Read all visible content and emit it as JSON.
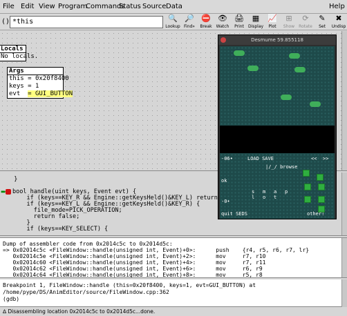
{
  "menubar": {
    "items": [
      "File",
      "Edit",
      "View",
      "Program",
      "Commands",
      "Status",
      "Source",
      "Data"
    ],
    "help": "Help"
  },
  "toolbar": {
    "arg_label": "():",
    "arg_value": "*this",
    "buttons": [
      {
        "label": "Lookup",
        "icon": "lookup-icon",
        "enabled": true
      },
      {
        "label": "Find»",
        "icon": "find-icon",
        "enabled": true
      },
      {
        "label": "Break",
        "icon": "break-icon",
        "enabled": true
      },
      {
        "label": "Watch",
        "icon": "watch-icon",
        "enabled": true
      },
      {
        "label": "Print",
        "icon": "print-icon",
        "enabled": true
      },
      {
        "label": "Display",
        "icon": "display-icon",
        "enabled": true
      },
      {
        "label": "Plot",
        "icon": "plot-icon",
        "enabled": true
      },
      {
        "label": "Show",
        "icon": "show-icon",
        "enabled": false
      },
      {
        "label": "Rotate",
        "icon": "rotate-icon",
        "enabled": false
      },
      {
        "label": "Set",
        "icon": "set-icon",
        "enabled": true
      },
      {
        "label": "Undisp",
        "icon": "undisp-icon",
        "enabled": true
      }
    ]
  },
  "data": {
    "locals": {
      "title": "Locals",
      "rows": [
        "No locals."
      ]
    },
    "args": {
      "title": "Args",
      "rows": [
        {
          "name": "this",
          "value": "= 0x20f8400"
        },
        {
          "name": "keys",
          "value": "= 1"
        },
        {
          "name": "evt ",
          "value": "= GUI_BUTTON"
        }
      ]
    }
  },
  "emulator": {
    "title": "Desmume 59.855118",
    "texts": {
      "hp": "-06•",
      "load_save": "LOAD SAVE",
      "nav": "<<  >>",
      "browse": "|/_/ browse",
      "ok": "ok",
      "col1": "s\nl",
      "col2": "m\no",
      "col3": "a\nt",
      "col4": "p",
      "zero": "-0•",
      "quit": "quit SEDS",
      "other": "other!"
    }
  },
  "source": {
    "lines": [
      "  }",
      "",
      "bool handle(uint keys, Event evt) {",
      "    if (keys==KEY_R && Engine::getKeysHeld()&KEY_L) return false;",
      "    if (keys==KEY_L && Engine::getKeysHeld()&KEY_R) {",
      "      file_mode=PICK_OPERATION;",
      "      return false;",
      "    }",
      "    if (keys==KEY_SELECT) {"
    ]
  },
  "machine": {
    "lines": [
      "Dump of assembler code from 0x2014c5c to 0x2014d5c:",
      "=> 0x02014c5c <FileWindow::handle(unsigned int, Event)+0>:      push    {r4, r5, r6, r7, lr}",
      "   0x02014c5e <FileWindow::handle(unsigned int, Event)+2>:      mov     r7, r10",
      "   0x02014c60 <FileWindow::handle(unsigned int, Event)+4>:      mov     r7, r11",
      "   0x02014c62 <FileWindow::handle(unsigned int, Event)+6>:      mov     r6, r9",
      "   0x02014c64 <FileWindow::handle(unsigned int, Event)+8>:      mov     r5, r8"
    ]
  },
  "console": {
    "lines": [
      "Breakpoint 1, FileWindow::handle (this=0x20f8400, keys=1, evt=GUI_BUTTON) at",
      "/home/pype/DS/AnimEditor/source/FileWindow.cpp:362",
      "(gdb) "
    ]
  },
  "status": {
    "text": "∆ Disassembling location 0x2014c5c to 0x2014d5c...done."
  }
}
